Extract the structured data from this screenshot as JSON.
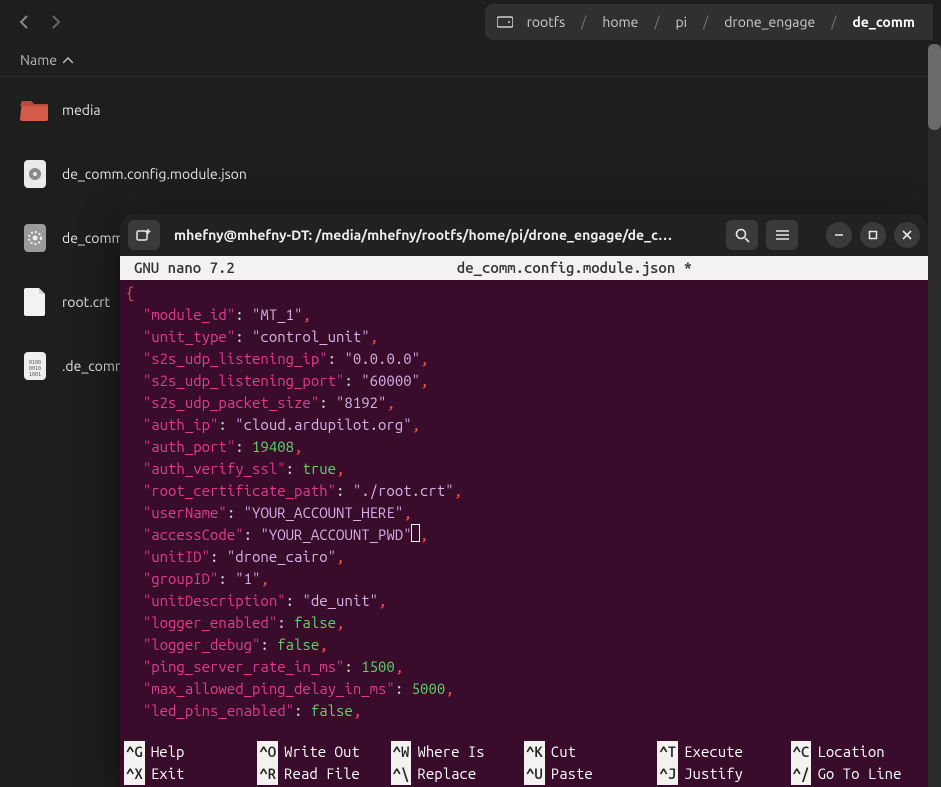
{
  "breadcrumb": {
    "root_icon": "disk",
    "segments": [
      "rootfs",
      "home",
      "pi",
      "drone_engage",
      "de_comm"
    ]
  },
  "filemgr": {
    "column_header": "Name",
    "files": [
      {
        "name": "media",
        "type": "folder"
      },
      {
        "name": "de_comm.config.module.json",
        "type": "json"
      },
      {
        "name": "de_comm",
        "type": "gear"
      },
      {
        "name": "root.crt",
        "type": "text"
      },
      {
        "name": ".de_comm",
        "type": "binary"
      }
    ]
  },
  "terminal": {
    "title": "mhefny@mhefny-DT: /media/mhefny/rootfs/home/pi/drone_engage/de_c…",
    "nano_version": "GNU nano 7.2",
    "nano_file": "de_comm.config.module.json *",
    "config": {
      "module_id": "MT_1",
      "unit_type": "control_unit",
      "s2s_udp_listening_ip": "0.0.0.0",
      "s2s_udp_listening_port": "60000",
      "s2s_udp_packet_size": "8192",
      "auth_ip": "cloud.ardupilot.org",
      "auth_port": 19408,
      "auth_verify_ssl": true,
      "root_certificate_path": "./root.crt",
      "userName": "YOUR_ACCOUNT_HERE",
      "accessCode": "YOUR_ACCOUNT_PWD",
      "unitID": "drone_cairo",
      "groupID": "1",
      "unitDescription": "de_unit",
      "logger_enabled": false,
      "logger_debug": false,
      "ping_server_rate_in_ms": 1500,
      "max_allowed_ping_delay_in_ms": 5000,
      "led_pins_enabled": false
    },
    "footer": [
      {
        "key": "^G",
        "label": "Help"
      },
      {
        "key": "^O",
        "label": "Write Out"
      },
      {
        "key": "^W",
        "label": "Where Is"
      },
      {
        "key": "^K",
        "label": "Cut"
      },
      {
        "key": "^T",
        "label": "Execute"
      },
      {
        "key": "^C",
        "label": "Location"
      },
      {
        "key": "^X",
        "label": "Exit"
      },
      {
        "key": "^R",
        "label": "Read File"
      },
      {
        "key": "^\\",
        "label": "Replace"
      },
      {
        "key": "^U",
        "label": "Paste"
      },
      {
        "key": "^J",
        "label": "Justify"
      },
      {
        "key": "^/",
        "label": "Go To Line"
      }
    ]
  }
}
